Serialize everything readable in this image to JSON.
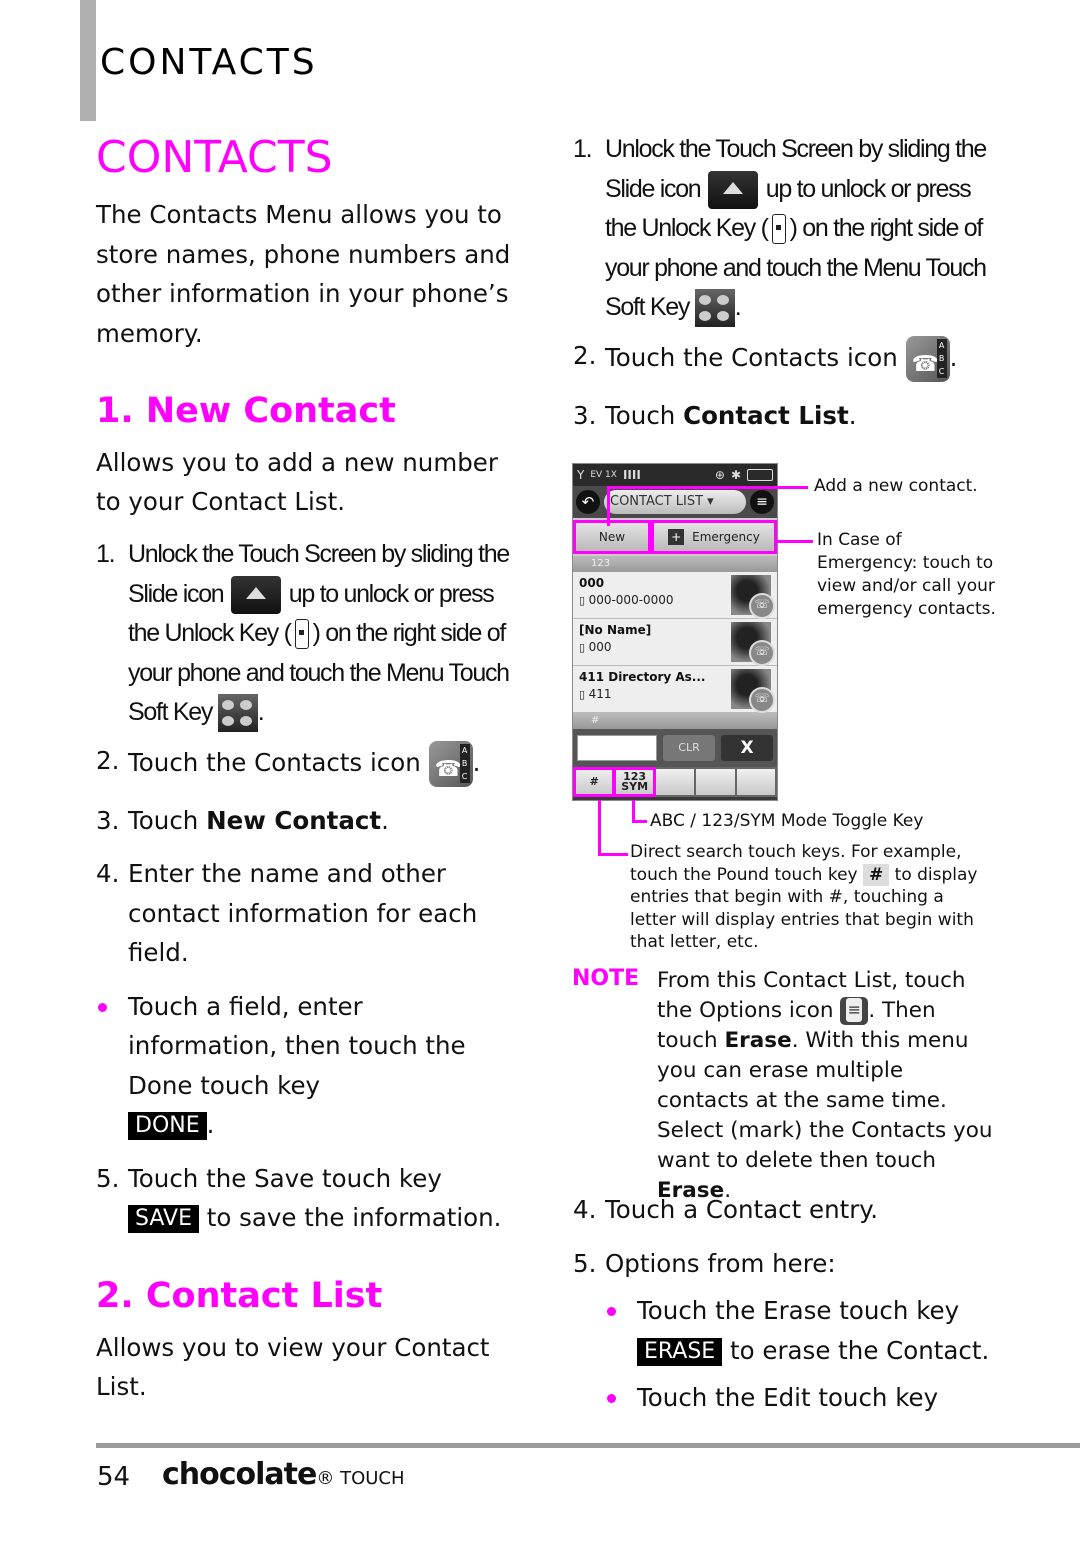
{
  "header": {
    "title": "CONTACTS"
  },
  "page_title": "CONTACTS",
  "intro": "The Contacts Menu allows you to store names, phone numbers and other information in your phone’s memory.",
  "sections": {
    "new_contact": {
      "title": "1. New Contact",
      "desc": "Allows you to add a new number to your Contact List.",
      "steps": {
        "s1": {
          "num": "1.",
          "part1": "Unlock the Touch Screen by sliding the Slide icon",
          "part2": "up to unlock or press the Unlock Key (",
          "part3": ") on the right side of your phone and touch the Menu Touch Soft Key",
          "part4": "."
        },
        "s2": {
          "num": "2.",
          "text": "Touch the Contacts icon",
          "end": "."
        },
        "s3": {
          "num": "3.",
          "text": "Touch ",
          "bold": "New Contact",
          "end": "."
        },
        "s4": {
          "num": "4.",
          "text": "Enter the name and other contact information for each field."
        },
        "bullet": {
          "text": "Touch a field, enter information, then touch the Done touch key",
          "key": "DONE",
          "end": "."
        },
        "s5": {
          "num": "5.",
          "text": "Touch the Save touch key",
          "key": "SAVE",
          "end": "to save the information."
        }
      }
    },
    "contact_list": {
      "title": "2. Contact List",
      "desc": "Allows you to view your Contact List.",
      "steps": {
        "s1": {
          "num": "1.",
          "part1": "Unlock the Touch Screen by sliding the Slide icon",
          "part2": "up to unlock or press the Unlock Key (",
          "part3": ") on the right side of your phone and touch the Menu Touch Soft Key",
          "part4": "."
        },
        "s2": {
          "num": "2.",
          "text": "Touch the Contacts icon",
          "end": "."
        },
        "s3": {
          "num": "3.",
          "text": "Touch ",
          "bold": "Contact List",
          "end": "."
        },
        "s4": {
          "num": "4.",
          "text": "Touch a Contact entry."
        },
        "s5": {
          "num": "5.",
          "text": "Options from here:"
        },
        "b1": {
          "text": "Touch the Erase touch key",
          "key": "ERASE",
          "end": "to erase the Contact."
        },
        "b2": {
          "text": "Touch the Edit touch key"
        }
      }
    }
  },
  "phone": {
    "status": {
      "signal": "Y",
      "network": "EV 1X",
      "bars": "IIII",
      "gps": "⊕",
      "bluetooth": "✱"
    },
    "title": "CONTACT LIST ▾",
    "back_icon": "↶",
    "options_icon": "≡",
    "new_label": "New",
    "plus": "+",
    "emergency_label": "Emergency",
    "group_123": "123",
    "group_pound": "#",
    "contacts": [
      {
        "name": "000",
        "number": "000-000-0000"
      },
      {
        "name": "[No Name]",
        "number": "000"
      },
      {
        "name": "411 Directory As...",
        "number": "411"
      }
    ],
    "clr_label": "CLR",
    "close_label": "X",
    "keys": [
      "#",
      "123 SYM",
      "",
      "",
      ""
    ]
  },
  "callouts": {
    "add_new": "Add a new contact.",
    "emergency": "In Case of Emergency: touch to view and/or call your emergency contacts.",
    "mode_toggle": "ABC / 123/SYM Mode Toggle Key",
    "direct_search_1": "Direct search touch keys. For example, touch the Pound touch key",
    "direct_search_pound": "#",
    "direct_search_2": "to display entries that begin with #, touching a letter will display entries that begin with that letter, etc."
  },
  "note": {
    "label": "NOTE",
    "t1": "From this Contact List, touch the Options icon",
    "t2": ". Then touch ",
    "b1": "Erase",
    "t3": ". With this menu you can erase multiple contacts at the same time. Select (mark) the Contacts you want to delete then touch ",
    "b2": "Erase",
    "t4": "."
  },
  "footer": {
    "page_number": "54",
    "brand": "chocolate",
    "brand_suffix": "® TOUCH"
  },
  "colors": {
    "accent": "#ff00ff",
    "header_bar": "#b0b0b0",
    "footer_rule": "#9b9b9b"
  }
}
